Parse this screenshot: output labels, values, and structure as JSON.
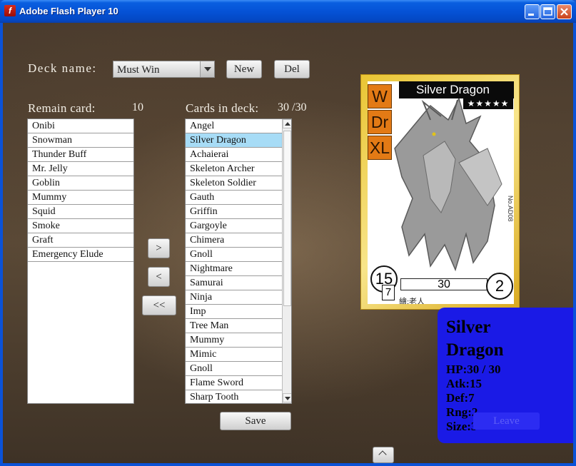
{
  "window": {
    "title": "Adobe Flash Player 10"
  },
  "deck": {
    "name_label": "Deck name:",
    "selected_deck": "Must Win",
    "new_label": "New",
    "del_label": "Del"
  },
  "remain": {
    "label": "Remain card:",
    "count": "10",
    "items": [
      "Onibi",
      "Snowman",
      "Thunder Buff",
      "Mr. Jelly",
      "Goblin",
      "Mummy",
      "Squid",
      "Smoke",
      "Graft",
      "Emergency Elude"
    ]
  },
  "in_deck": {
    "label": "Cards in deck:",
    "count": "30 /30",
    "selected": "Silver Dragon",
    "items": [
      "Angel",
      "Silver Dragon",
      "Achaierai",
      "Skeleton Archer",
      "Skeleton Soldier",
      "Gauth",
      "Griffin",
      "Gargoyle",
      "Chimera",
      "Gnoll",
      "Nightmare",
      "Samurai",
      "Ninja",
      "Imp",
      "Tree Man",
      "Mummy",
      "Mimic",
      "Gnoll",
      "Flame Sword",
      "Sharp Tooth"
    ]
  },
  "transfer": {
    "add": ">",
    "remove": "<",
    "remove_all": "<<"
  },
  "save_label": "Save",
  "card": {
    "name": "Silver Dragon",
    "stars": "★★★★★",
    "tags": [
      "W",
      "Dr",
      "XL"
    ],
    "number": "No.AD08",
    "atk": "15",
    "def": "7",
    "hp": "30",
    "rng": "2",
    "artist": "繪:老人"
  },
  "info": {
    "name": "Silver Dragon",
    "hp": "HP:30 / 30",
    "atk": "Atk:15",
    "def": "Def:7",
    "rng": "Rng:2",
    "size": "Size:3",
    "leave_label": "Leave"
  },
  "colors": {
    "accent_selection": "#a7dcf6",
    "info_panel": "#1a1ae6",
    "card_border": "#e9c433"
  }
}
